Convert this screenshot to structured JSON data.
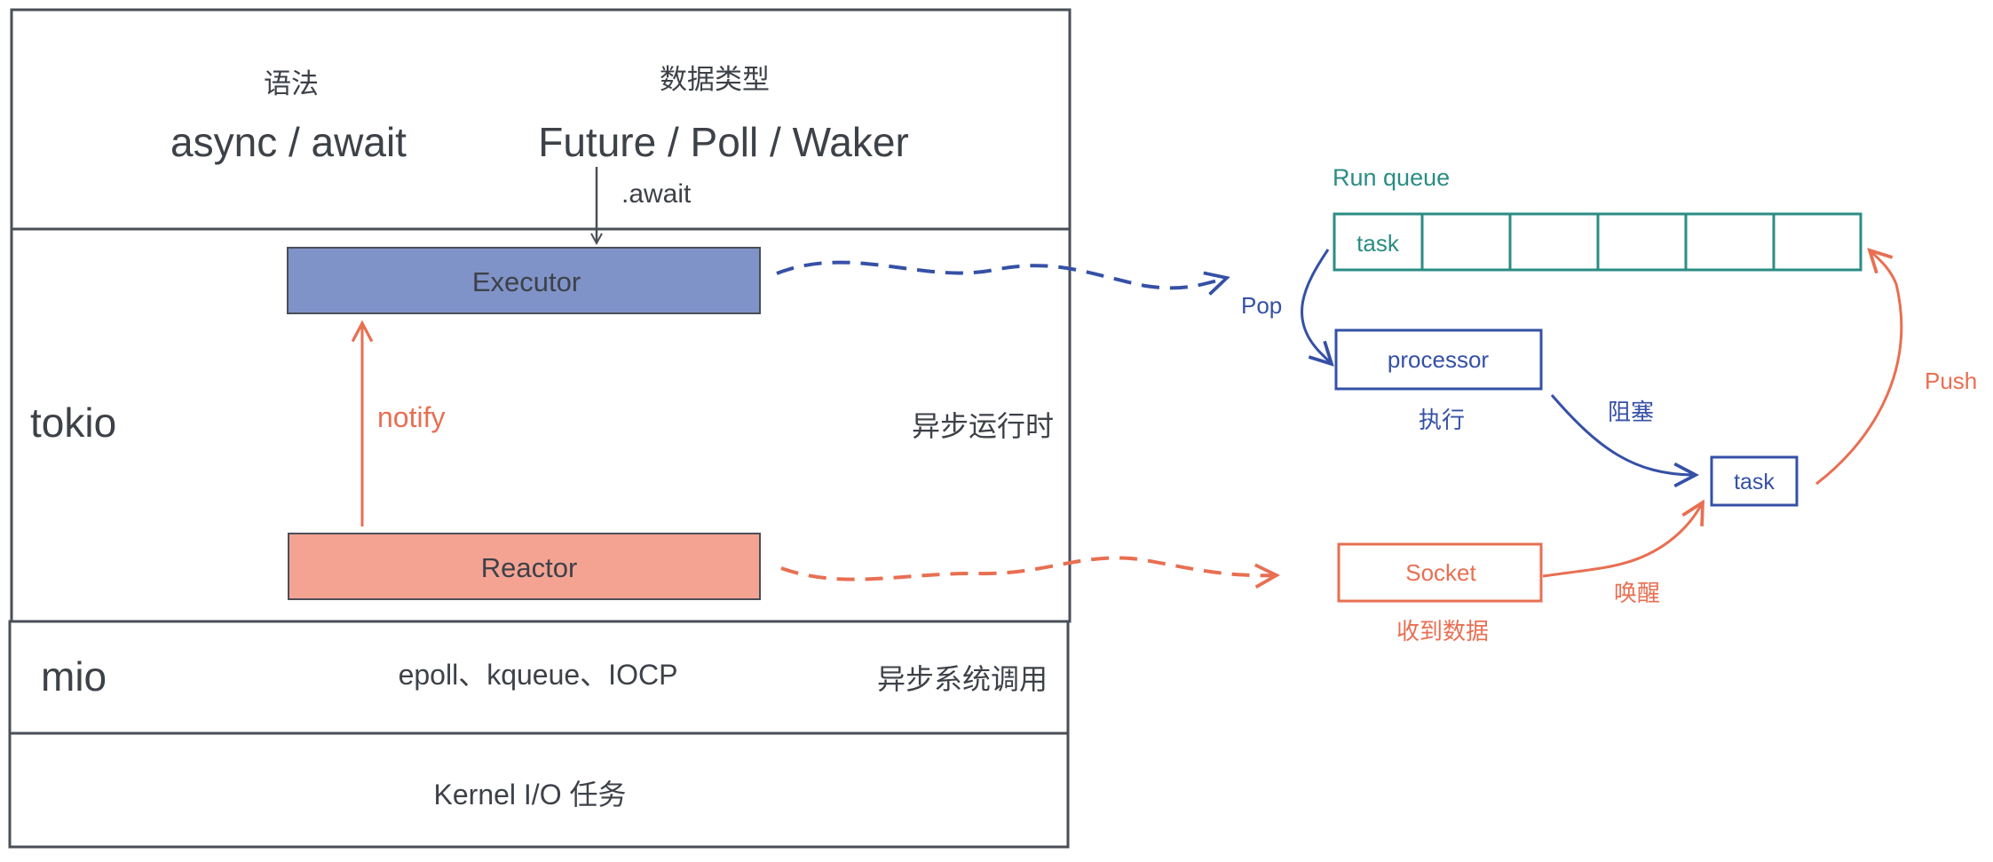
{
  "layers": {
    "syntax_heading": "语法",
    "syntax_value": "async / await",
    "types_heading": "数据类型",
    "types_value": "Future / Poll / Waker",
    "await_label": ".await",
    "executor_label": "Executor",
    "notify_label": "notify",
    "tokio_label": "tokio",
    "async_runtime_label": "异步运行时",
    "reactor_label": "Reactor",
    "mio_label": "mio",
    "mio_apis": "epoll、kqueue、IOCP",
    "async_syscall_label": "异步系统调用",
    "kernel_label": "Kernel I/O 任务"
  },
  "scheduler": {
    "run_queue_label": "Run queue",
    "queue_slots": [
      "task",
      "",
      "",
      "",
      "",
      ""
    ],
    "pop_label": "Pop",
    "processor_label": "processor",
    "execute_label": "执行",
    "block_label": "阻塞",
    "task_label": "task",
    "push_label": "Push",
    "socket_label": "Socket",
    "receive_label": "收到数据",
    "wake_label": "唤醒"
  },
  "colors": {
    "stroke": "#4a4f57",
    "text": "#3d4148",
    "executor_fill": "#7f93c9",
    "reactor_fill": "#f4a393",
    "blue": "#3550a6",
    "orange": "#e86f52",
    "teal": "#2b8d83"
  }
}
